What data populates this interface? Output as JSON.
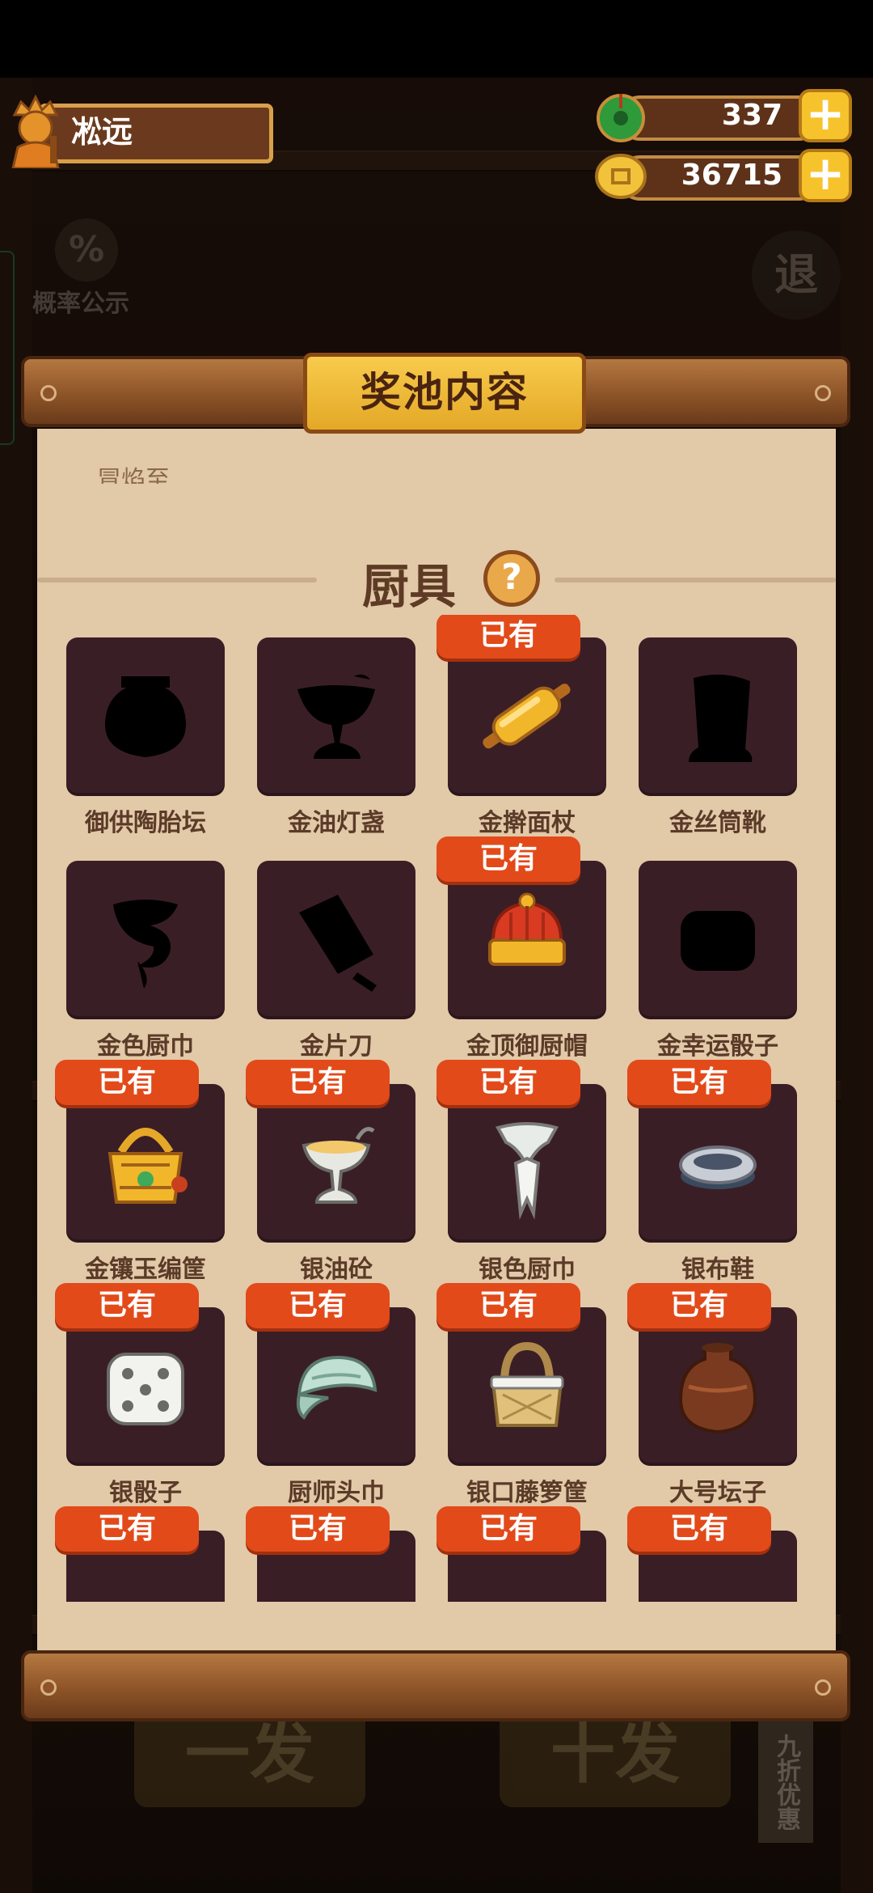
{
  "player": {
    "name": "凇远",
    "avatar_icon": "chef-avatar-icon"
  },
  "currency": {
    "jade": {
      "value": "337",
      "icon": "jade-icon"
    },
    "coin": {
      "value": "36715",
      "icon": "coin-icon"
    },
    "plus_label": "+"
  },
  "probability": {
    "icon_text": "%",
    "label": "概率公示"
  },
  "exit": {
    "label": "退"
  },
  "dialog": {
    "title": "奖池内容",
    "cut_texts": [
      "冒焰至"
    ],
    "section_title": "厨具",
    "help_label": "?"
  },
  "owned_label": "已有",
  "items": [
    {
      "name": "御供陶胎坛",
      "owned": false,
      "icon": "jar-silhouette-icon"
    },
    {
      "name": "金油灯盏",
      "owned": false,
      "icon": "oil-lamp-silhouette-icon"
    },
    {
      "name": "金擀面杖",
      "owned": true,
      "icon": "rolling-pin-icon"
    },
    {
      "name": "金丝筒靴",
      "owned": false,
      "icon": "boot-silhouette-icon"
    },
    {
      "name": "金色厨巾",
      "owned": false,
      "icon": "towel-silhouette-icon"
    },
    {
      "name": "金片刀",
      "owned": false,
      "icon": "cleaver-silhouette-icon"
    },
    {
      "name": "金顶御厨帽",
      "owned": true,
      "icon": "chef-hat-icon"
    },
    {
      "name": "金幸运骰子",
      "owned": false,
      "icon": "dice-silhouette-icon"
    },
    {
      "name": "金镶玉编筐",
      "owned": true,
      "icon": "gold-basket-icon"
    },
    {
      "name": "银油砼",
      "owned": true,
      "icon": "silver-oil-cup-icon"
    },
    {
      "name": "银色厨巾",
      "owned": true,
      "icon": "silver-towel-icon"
    },
    {
      "name": "银布鞋",
      "owned": true,
      "icon": "silver-shoe-icon"
    },
    {
      "name": "银骰子",
      "owned": true,
      "icon": "dice-icon"
    },
    {
      "name": "厨师头巾",
      "owned": true,
      "icon": "headscarf-icon"
    },
    {
      "name": "银口藤箩筐",
      "owned": true,
      "icon": "rattan-basket-icon"
    },
    {
      "name": "大号坛子",
      "owned": true,
      "icon": "big-jar-icon"
    },
    {
      "name": "",
      "owned": true,
      "icon": "item-icon"
    },
    {
      "name": "",
      "owned": true,
      "icon": "item-icon"
    },
    {
      "name": "",
      "owned": true,
      "icon": "item-icon"
    },
    {
      "name": "",
      "owned": true,
      "icon": "item-icon"
    }
  ],
  "bottom": {
    "single_draw": "一发",
    "ten_draw": "十发",
    "discount": "九折优惠"
  }
}
